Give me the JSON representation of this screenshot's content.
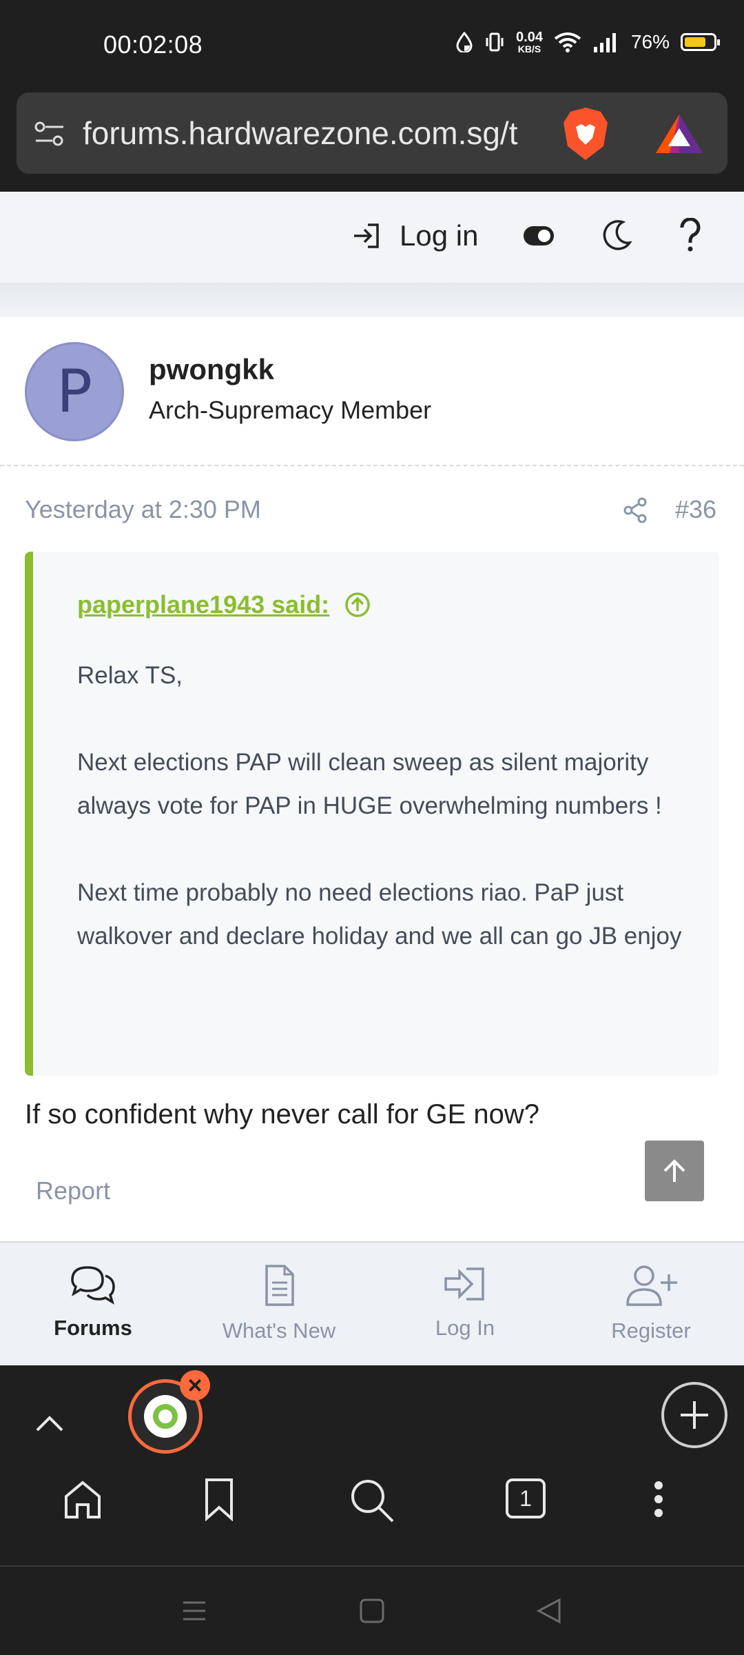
{
  "status_bar": {
    "time": "00:02:08",
    "net_speed_value": "0.04",
    "net_speed_unit": "KB/S",
    "battery": "76%",
    "battery_level": 0.76,
    "icons": [
      "data-saver-icon",
      "vibrate-icon",
      "wifi-icon",
      "signal-icon",
      "battery-icon"
    ]
  },
  "browser": {
    "url": "forums.hardwarezone.com.sg/t",
    "tab_count": "1"
  },
  "site_header": {
    "login_label": "Log in",
    "icons": [
      "login-icon",
      "toggle-icon",
      "moon-icon",
      "help-icon"
    ]
  },
  "post": {
    "avatar_letter": "P",
    "username": "pwongkk",
    "user_title": "Arch-Supremacy Member",
    "date": "Yesterday at 2:30 PM",
    "post_number": "#36",
    "quote": {
      "author": "paperplane1943 said:",
      "paragraphs": [
        "Relax TS,",
        "Next elections PAP will clean sweep as silent majority always vote for PAP in HUGE overwhelming numbers !",
        "Next time probably no need elections riao. PaP just walkover and declare holiday and we all can go JB enjoy"
      ]
    },
    "reply_text": "If so confident why never call for GE now?",
    "report_label": "Report"
  },
  "site_nav": {
    "tabs": [
      {
        "label": "Forums",
        "icon": "forums-icon",
        "active": true
      },
      {
        "label": "What's New",
        "icon": "whats-new-icon",
        "active": false
      },
      {
        "label": "Log In",
        "icon": "login-icon",
        "active": false
      },
      {
        "label": "Register",
        "icon": "register-icon",
        "active": false
      }
    ]
  },
  "colors": {
    "accent_green": "#8bbd2f",
    "muted_text": "#8a94a6",
    "browser_dark": "#1f1f1f",
    "avatar_bg": "#9a9fd4"
  }
}
